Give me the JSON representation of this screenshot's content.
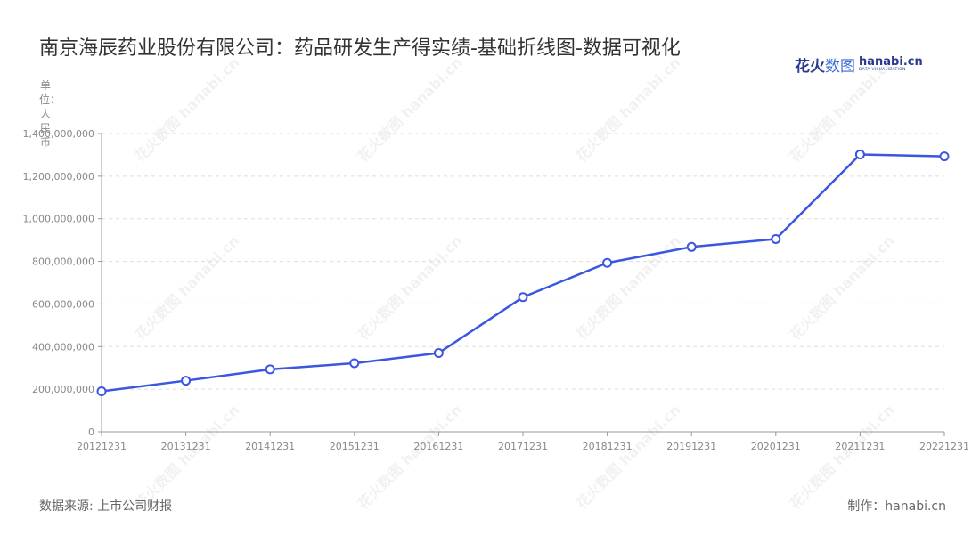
{
  "title": "南京海辰药业股份有限公司：药品研发生产得实绩-基础折线图-数据可视化",
  "unit_label": "单位：人民币",
  "logo": {
    "cn_dark": "花火",
    "cn_light": "数图",
    "en": "hanabi.cn",
    "en_sub": "DATA VISUALIZATION"
  },
  "watermark": "花火数图 hanabi.cn",
  "footer": {
    "source": "数据来源: 上市公司财报",
    "maker": "制作：hanabi.cn"
  },
  "colors": {
    "line": "#3b56e0",
    "grid": "#dddddd",
    "axis": "#999999",
    "tick_text": "#888888"
  },
  "chart_data": {
    "type": "line",
    "title": "南京海辰药业股份有限公司：药品研发生产得实绩-基础折线图-数据可视化",
    "ylabel": "单位：人民币",
    "xlabel": "",
    "categories": [
      "20121231",
      "20131231",
      "20141231",
      "20151231",
      "20161231",
      "20171231",
      "20181231",
      "20191231",
      "20201231",
      "20211231",
      "20221231"
    ],
    "series": [
      {
        "values": [
          190000000,
          240000000,
          293000000,
          322000000,
          370000000,
          632000000,
          793000000,
          868000000,
          905000000,
          1302000000,
          1293000000
        ]
      }
    ],
    "ylim": [
      0,
      1400000000
    ],
    "yticks": [
      0,
      200000000,
      400000000,
      600000000,
      800000000,
      1000000000,
      1200000000,
      1400000000
    ],
    "ytick_labels": [
      "0",
      "200,000,000",
      "400,000,000",
      "600,000,000",
      "800,000,000",
      "1,000,000,000",
      "1,200,000,000",
      "1,400,000,000"
    ],
    "grid": true,
    "legend": "none"
  }
}
